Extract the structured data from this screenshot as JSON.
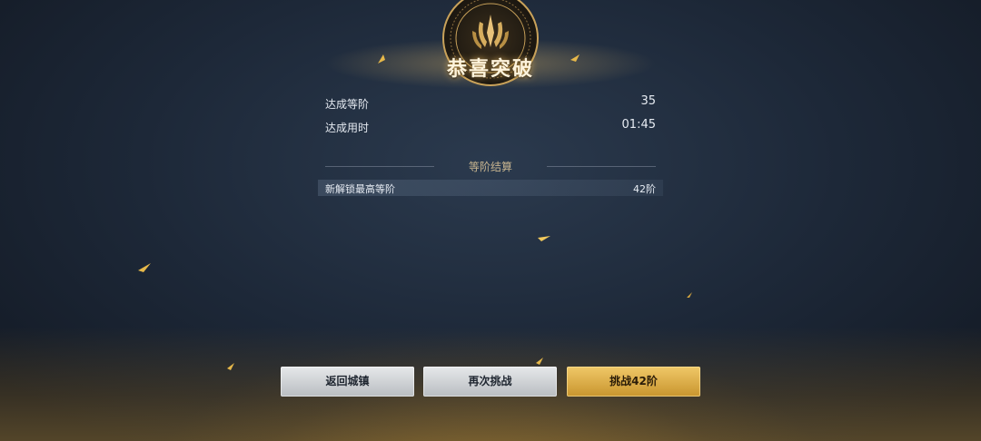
{
  "banner": {
    "title": "恭喜突破"
  },
  "stats": [
    {
      "label": "达成等阶",
      "value": "35"
    },
    {
      "label": "达成用时",
      "value": "01:45"
    }
  ],
  "settlement": {
    "heading": "等阶结算",
    "unlock_label": "新解锁最高等阶",
    "unlock_value": "42阶"
  },
  "buttons": {
    "return_label": "返回城镇",
    "retry_label": "再次挑战",
    "challenge_label": "挑战42阶"
  },
  "colors": {
    "accent_gold": "#d9a94a",
    "background": "#1d2838"
  },
  "icons": {
    "emblem": "rank-emblem-icon"
  }
}
